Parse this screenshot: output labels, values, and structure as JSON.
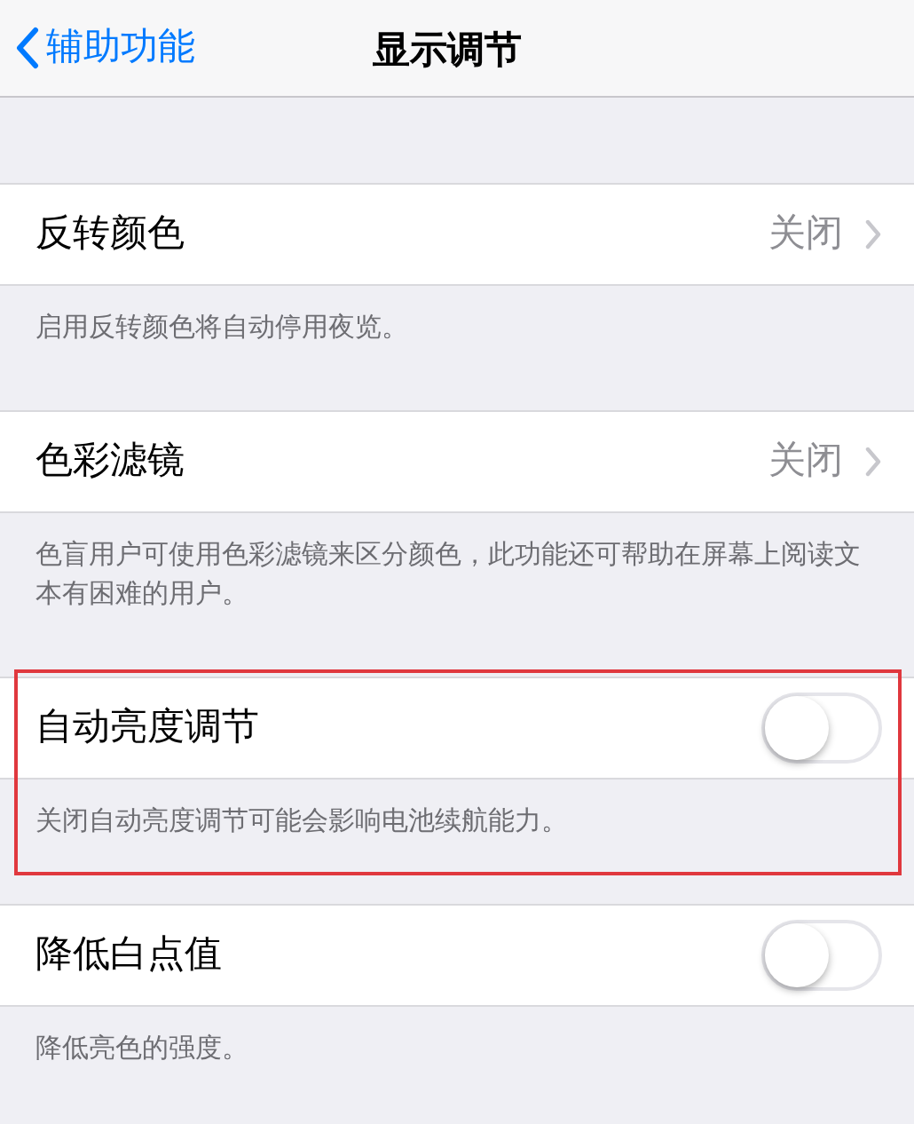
{
  "nav": {
    "back": "辅助功能",
    "title": "显示调节"
  },
  "sections": [
    {
      "kind": "disclosure",
      "title": "反转颜色",
      "value": "关闭",
      "footer": "启用反转颜色将自动停用夜览。",
      "highlighted": false
    },
    {
      "kind": "disclosure",
      "title": "色彩滤镜",
      "value": "关闭",
      "footer": "色盲用户可使用色彩滤镜来区分颜色，此功能还可帮助在屏幕上阅读文本有困难的用户。",
      "highlighted": false
    },
    {
      "kind": "toggle",
      "title": "自动亮度调节",
      "on": false,
      "footer": "关闭自动亮度调节可能会影响电池续航能力。",
      "highlighted": true
    },
    {
      "kind": "toggle",
      "title": "降低白点值",
      "on": false,
      "footer": "降低亮色的强度。",
      "highlighted": false
    }
  ]
}
